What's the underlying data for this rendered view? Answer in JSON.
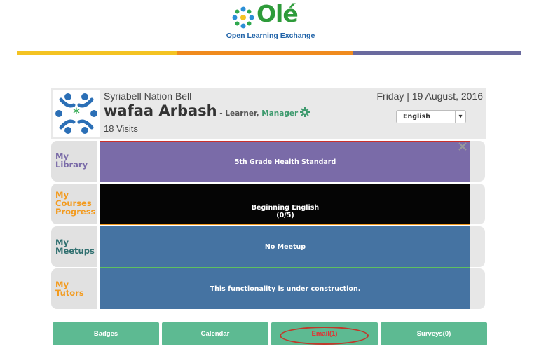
{
  "logo": {
    "word": "Olé",
    "subtitle": "Open Learning Exchange",
    "icon": "ole-flower-logo-icon"
  },
  "colorbar": [
    "#f4c322",
    "#f08b1e",
    "#6a6a9e"
  ],
  "header": {
    "community": "Syriabell Nation Bell",
    "date": "Friday | 19 August, 2016",
    "user_name": "wafaa Arbash",
    "role_prefix": " - Learner, ",
    "role_manager": "Manager",
    "visits": "18 Visits",
    "language": "English",
    "avatar_icon": "community-avatar-icon",
    "settings_icon": "gear-icon"
  },
  "rows": [
    {
      "label_line1": "My",
      "label_line2": "Library",
      "label_line3": "",
      "content_line1": "5th Grade Health Standard",
      "content_line2": "",
      "label_color": "#7a6ba8",
      "panel_color": "#7a6ba8"
    },
    {
      "label_line1": "My",
      "label_line2": "Courses",
      "label_line3": "Progress",
      "content_line1": "Beginning English",
      "content_line2": "(0/5)",
      "label_color": "#f39b1f",
      "panel_color": "#050505"
    },
    {
      "label_line1": "My",
      "label_line2": "Meetups",
      "label_line3": "",
      "content_line1": "No Meetup",
      "content_line2": "",
      "label_color": "#2f6f6f",
      "panel_color": "#4573a2"
    },
    {
      "label_line1": "My",
      "label_line2": "Tutors",
      "label_line3": "",
      "content_line1": "This functionality is under construction.",
      "content_line2": "",
      "label_color": "#f39b1f",
      "panel_color": "#4573a2"
    }
  ],
  "buttons": {
    "badges": "Badges",
    "calendar": "Calendar",
    "email": "Email(1)",
    "surveys": "Surveys(0)"
  },
  "colors": {
    "button_bg": "#5dba92",
    "email_text": "#e03535",
    "highlight_oval": "#c0392b"
  }
}
